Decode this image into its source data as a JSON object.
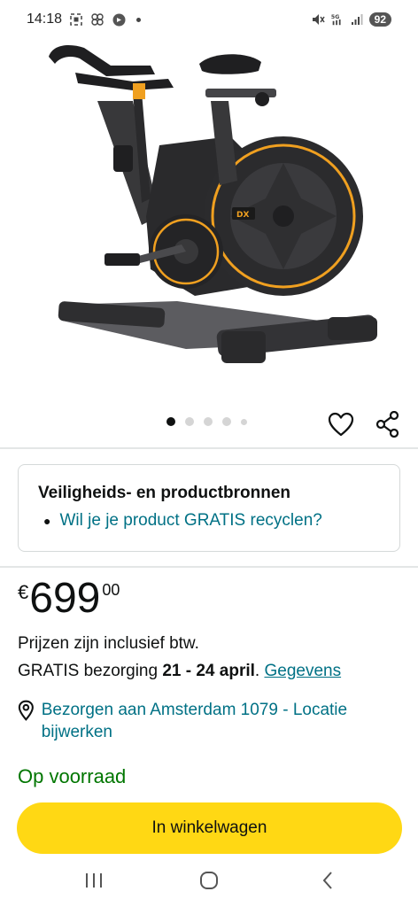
{
  "status_bar": {
    "time": "14:18",
    "network": "5G",
    "battery": "92",
    "icons": [
      "screenshot-icon",
      "pinwheel-icon",
      "app-badge-icon",
      "notification-dot",
      "mute-icon",
      "wifi-5g-icon",
      "signal-icon",
      "battery-icon"
    ]
  },
  "product_image": {
    "alt": "Spinning bike",
    "colors": {
      "frame": "#2a2a2c",
      "accent": "#f0a020",
      "base": "#5c5c60"
    },
    "brand_badge": "DX"
  },
  "carousel": {
    "count": 5,
    "active_index": 0
  },
  "safety": {
    "title": "Veiligheids- en productbronnen",
    "link": "Wil je je product GRATIS recyclen?"
  },
  "price": {
    "currency": "€",
    "whole": "699",
    "fraction": "00"
  },
  "tax_note": "Prijzen zijn inclusief btw.",
  "delivery": {
    "prefix": "GRATIS bezorging",
    "dates": "21 - 24 april",
    "separator": ".",
    "details_link": "Gegevens"
  },
  "location": {
    "text": "Bezorgen aan Amsterdam 1079 - Locatie bijwerken"
  },
  "stock": "Op voorraad",
  "cart_button": "In winkelwagen",
  "colors": {
    "link": "#007185",
    "stock": "#007600",
    "cart_button": "#ffd814"
  }
}
